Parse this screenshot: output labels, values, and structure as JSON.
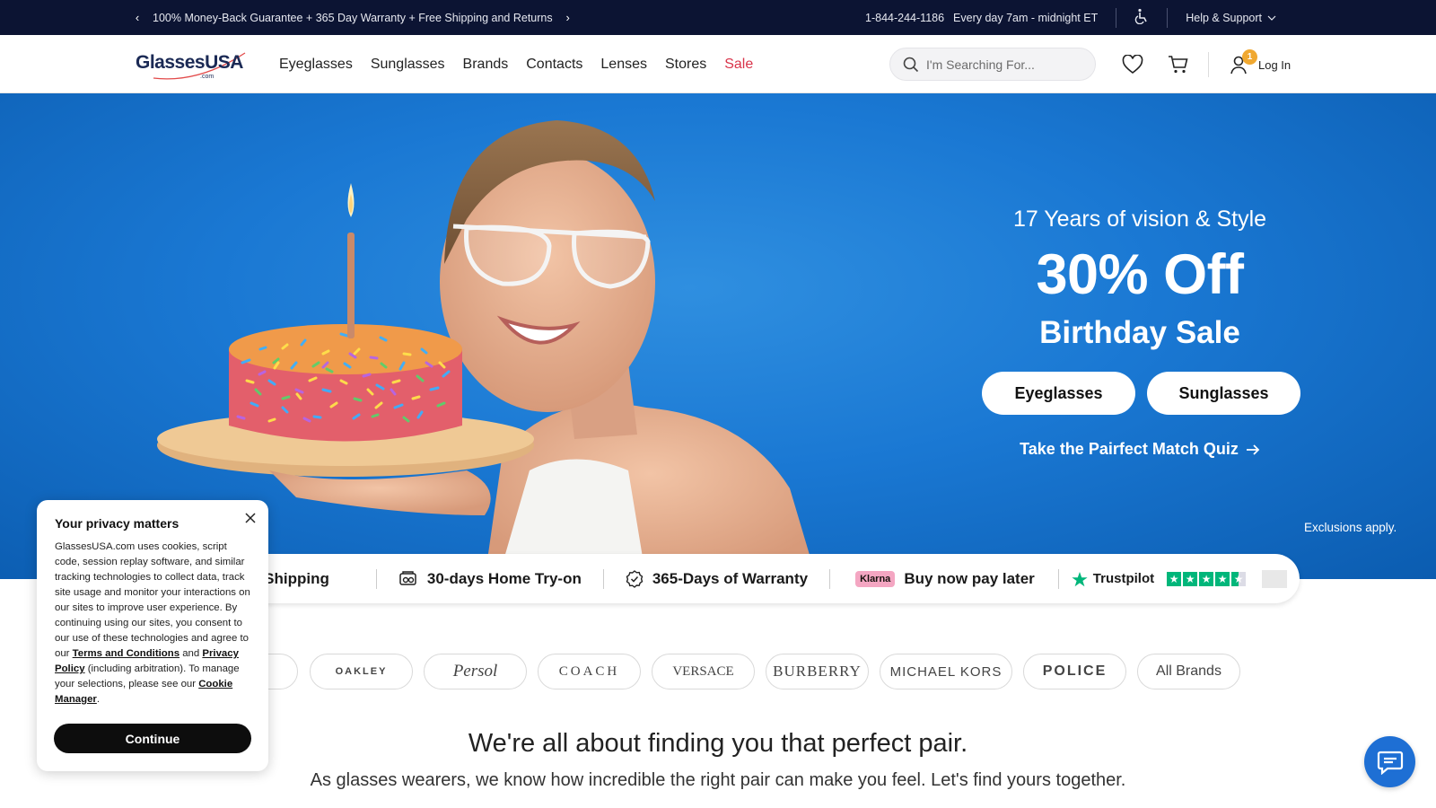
{
  "topbar": {
    "promo": "100% Money-Back Guarantee + 365 Day Warranty + Free Shipping and Returns",
    "phone": "1-844-244-1186",
    "hours": "Every day 7am - midnight ET",
    "help": "Help & Support"
  },
  "logo": {
    "text": "GlassesUSA",
    "suffix": ".com"
  },
  "nav": {
    "items": [
      "Eyeglasses",
      "Sunglasses",
      "Brands",
      "Contacts",
      "Lenses",
      "Stores",
      "Sale"
    ],
    "search_placeholder": "I'm Searching For...",
    "cart_count": "1",
    "login": "Log In"
  },
  "hero": {
    "subtitle": "17 Years of vision & Style",
    "headline": "30% Off",
    "subheadline": "Birthday Sale",
    "btn_eyeglasses": "Eyeglasses",
    "btn_sunglasses": "Sunglasses",
    "quiz": "Take the Pairfect Match Quiz",
    "exclusions": "Exclusions apply."
  },
  "benefits": {
    "shipping": "e Shipping",
    "tryon": "30-days Home Try-on",
    "warranty": "365-Days of Warranty",
    "klarna_badge": "Klarna",
    "bnpl": "Buy now pay later",
    "trustpilot": "Trustpilot",
    "trustpilot_rating_stars": 4.5
  },
  "brands": [
    "OAKLEY",
    "Persol",
    "COACH",
    "VERSACE",
    "BURBERRY",
    "MICHAEL KORS",
    "POLICE",
    "All Brands"
  ],
  "headline": "We're all about finding you that perfect pair.",
  "subline": "As glasses wearers, we know how incredible the right pair can make you feel. Let's find yours together.",
  "privacy": {
    "title": "Your privacy matters",
    "body_1": "GlassesUSA.com uses cookies, script code, session replay software, and similar tracking technologies to collect data, track site usage and monitor your interactions on our sites to improve user experience. By continuing using our sites, you consent to our use of these technologies and agree to our ",
    "terms": "Terms and Conditions",
    "and": " and ",
    "policy": "Privacy Policy",
    "body_2": " (including arbitration). To manage your selections, please see our ",
    "cookie": "Cookie Manager",
    "end": ".",
    "continue": "Continue"
  },
  "colors": {
    "topbar": "#0c1433",
    "hero_blue": "#1a78d3",
    "sale_red": "#d9344a",
    "badge": "#f0a830",
    "trustpilot": "#00b67a",
    "chat": "#1e6fd4"
  }
}
